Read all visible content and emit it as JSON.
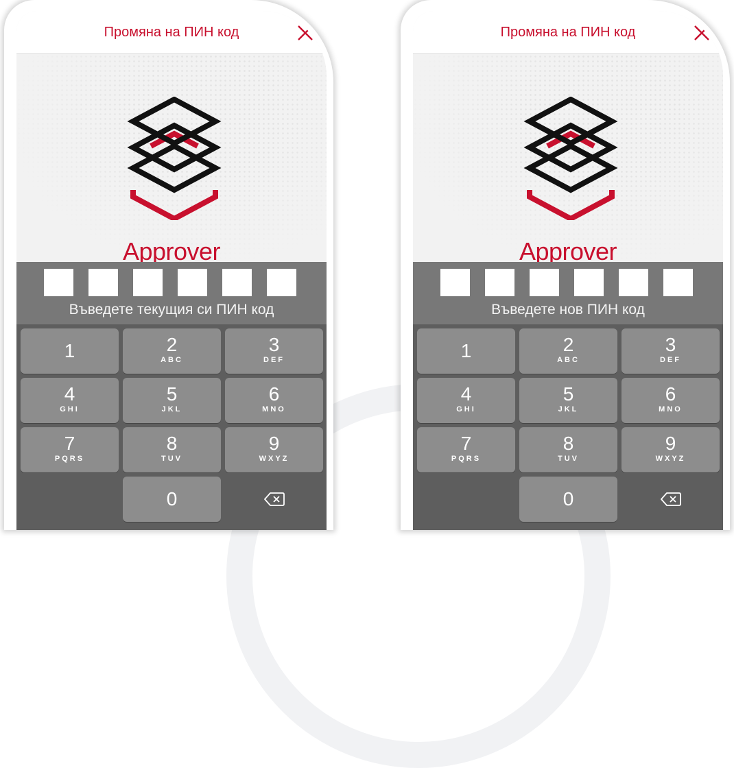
{
  "colors": {
    "accent": "#c8102e",
    "keypad_bg": "#5e5e5e",
    "key_bg": "#8d8d8d",
    "pin_area_bg": "#787878"
  },
  "screens": [
    {
      "header": {
        "title": "Промяна на ПИН код",
        "close_icon": "close-icon"
      },
      "logo": {
        "icon": "stacked-layers-logo",
        "name": "Approver"
      },
      "pin": {
        "length": 6,
        "prompt": "Въведете текущия си ПИН код"
      },
      "keypad": {
        "keys": [
          {
            "num": "1",
            "letters": ""
          },
          {
            "num": "2",
            "letters": "ABC"
          },
          {
            "num": "3",
            "letters": "DEF"
          },
          {
            "num": "4",
            "letters": "GHI"
          },
          {
            "num": "5",
            "letters": "JKL"
          },
          {
            "num": "6",
            "letters": "MNO"
          },
          {
            "num": "7",
            "letters": "PQRS"
          },
          {
            "num": "8",
            "letters": "TUV"
          },
          {
            "num": "9",
            "letters": "WXYZ"
          },
          {
            "num": "0",
            "letters": ""
          }
        ],
        "delete_icon": "backspace-icon"
      }
    },
    {
      "header": {
        "title": "Промяна на ПИН код",
        "close_icon": "close-icon"
      },
      "logo": {
        "icon": "stacked-layers-logo",
        "name": "Approver"
      },
      "pin": {
        "length": 6,
        "prompt": "Въведете нов ПИН код"
      },
      "keypad": {
        "keys": [
          {
            "num": "1",
            "letters": ""
          },
          {
            "num": "2",
            "letters": "ABC"
          },
          {
            "num": "3",
            "letters": "DEF"
          },
          {
            "num": "4",
            "letters": "GHI"
          },
          {
            "num": "5",
            "letters": "JKL"
          },
          {
            "num": "6",
            "letters": "MNO"
          },
          {
            "num": "7",
            "letters": "PQRS"
          },
          {
            "num": "8",
            "letters": "TUV"
          },
          {
            "num": "9",
            "letters": "WXYZ"
          },
          {
            "num": "0",
            "letters": ""
          }
        ],
        "delete_icon": "backspace-icon"
      }
    }
  ]
}
